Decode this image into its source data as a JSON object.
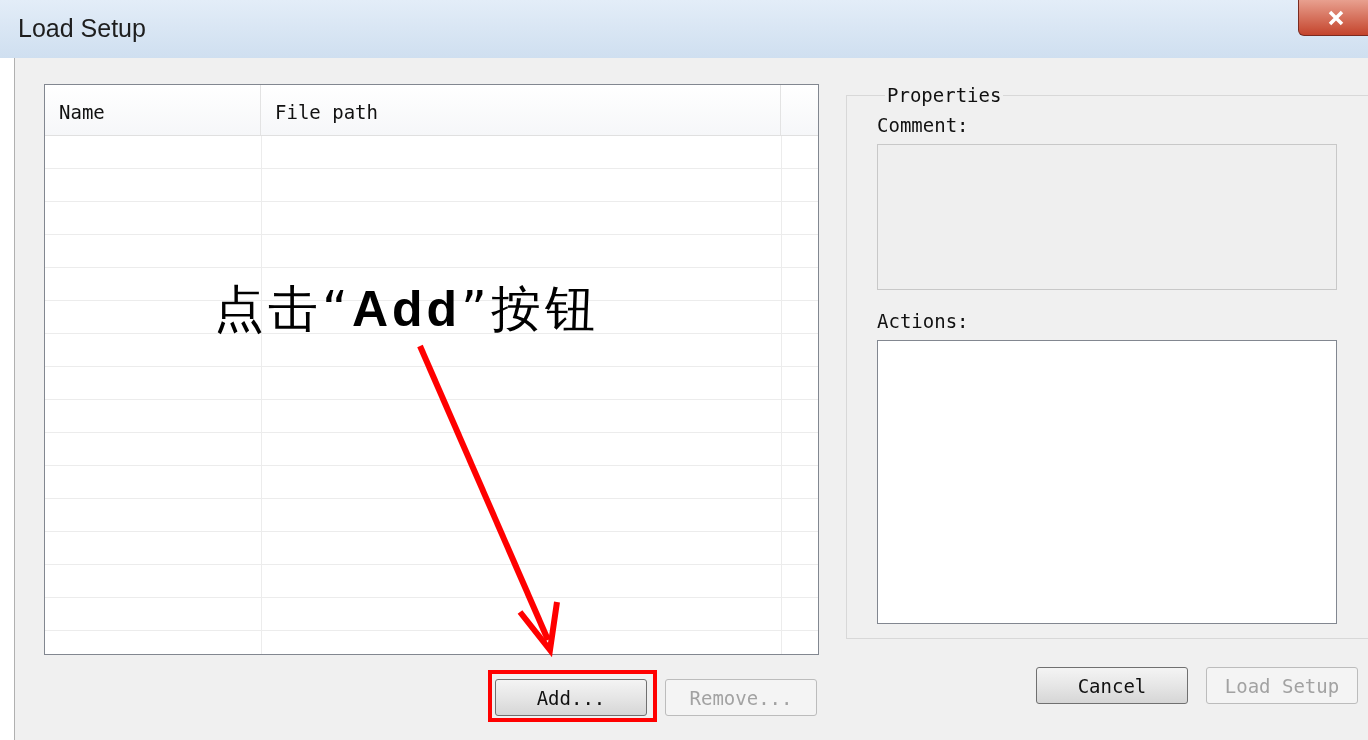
{
  "window": {
    "title": "Load Setup"
  },
  "table": {
    "columns": [
      "Name",
      "File path"
    ]
  },
  "properties": {
    "title": "Properties",
    "comment_label": "Comment:",
    "actions_label": "Actions:"
  },
  "left_buttons": [
    {
      "label": "Add...",
      "disabled": false
    },
    {
      "label": "Remove...",
      "disabled": true
    }
  ],
  "right_buttons": [
    {
      "label": "Cancel",
      "disabled": false
    },
    {
      "label": "Load Setup",
      "disabled": true
    }
  ],
  "annotation": {
    "text": "点击“**Add**”按钮"
  }
}
